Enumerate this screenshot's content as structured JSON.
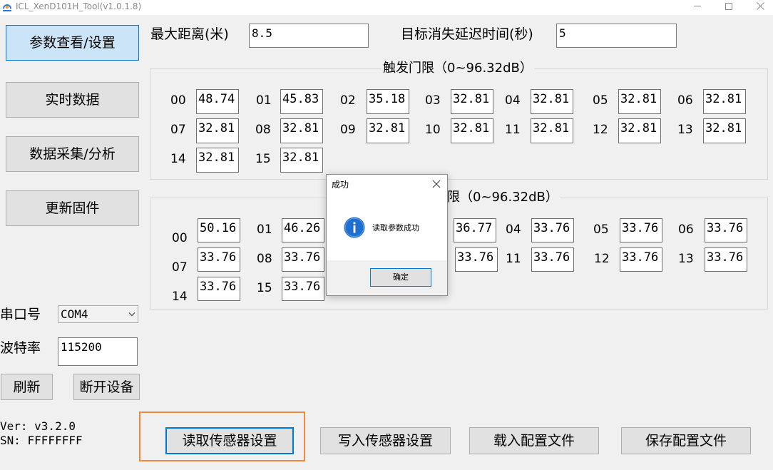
{
  "window": {
    "title": "ICL_XenD101H_Tool(v1.0.1.8)",
    "icon": "app-logo-icon",
    "controls": [
      "minimize-icon",
      "maximize-icon",
      "close-icon"
    ]
  },
  "sidebar": {
    "items": [
      {
        "label": "参数查看/设置",
        "selected": true
      },
      {
        "label": "实时数据",
        "selected": false
      },
      {
        "label": "数据采集/分析",
        "selected": false
      },
      {
        "label": "更新固件",
        "selected": false
      }
    ]
  },
  "connection": {
    "port_label": "串口号",
    "port_value": "COM4",
    "baud_label": "波特率",
    "baud_value": "115200",
    "refresh_label": "刷新",
    "disconnect_label": "断开设备"
  },
  "device_info": {
    "version": "Ver: v3.2.0",
    "sn": "SN: FFFFFFFF"
  },
  "params": {
    "max_distance_label": "最大距离(米)",
    "max_distance_value": "8.5",
    "disappear_delay_label": "目标消失延迟时间(秒)",
    "disappear_delay_value": "5"
  },
  "trigger_threshold": {
    "title": "触发门限（0~96.32dB）",
    "gates": [
      {
        "id": "00",
        "value": "48.74"
      },
      {
        "id": "01",
        "value": "45.83"
      },
      {
        "id": "02",
        "value": "35.18"
      },
      {
        "id": "03",
        "value": "32.81"
      },
      {
        "id": "04",
        "value": "32.81"
      },
      {
        "id": "05",
        "value": "32.81"
      },
      {
        "id": "06",
        "value": "32.81"
      },
      {
        "id": "07",
        "value": "32.81"
      },
      {
        "id": "08",
        "value": "32.81"
      },
      {
        "id": "09",
        "value": "32.81"
      },
      {
        "id": "10",
        "value": "32.81"
      },
      {
        "id": "11",
        "value": "32.81"
      },
      {
        "id": "12",
        "value": "32.81"
      },
      {
        "id": "13",
        "value": "32.81"
      },
      {
        "id": "14",
        "value": "32.81"
      },
      {
        "id": "15",
        "value": "32.81"
      }
    ]
  },
  "second_threshold": {
    "title_visible": "限（0~96.32dB）",
    "gates": [
      {
        "id": "00",
        "value": "50.16"
      },
      {
        "id": "01",
        "value": "46.26"
      },
      {
        "value": "36.77"
      },
      {
        "id": "04",
        "value": "33.76"
      },
      {
        "id": "05",
        "value": "33.76"
      },
      {
        "id": "06",
        "value": "33.76"
      },
      {
        "id": "07",
        "value": "33.76"
      },
      {
        "id": "08",
        "value": "33.76"
      },
      {
        "value": "33.76"
      },
      {
        "id": "11",
        "value": "33.76"
      },
      {
        "id": "12",
        "value": "33.76"
      },
      {
        "id": "13",
        "value": "33.76"
      },
      {
        "id": "14",
        "value": "33.76"
      },
      {
        "id": "15",
        "value": "33.76"
      }
    ]
  },
  "dialog": {
    "title": "成功",
    "message": "读取参数成功",
    "ok_label": "确定",
    "icon": "info-icon"
  },
  "actions": {
    "read": {
      "label": "读取传感器设置",
      "focused": true
    },
    "write": {
      "label": "写入传感器设置",
      "focused": false
    },
    "load": {
      "label": "载入配置文件",
      "focused": false
    },
    "save": {
      "label": "保存配置文件",
      "focused": false
    }
  },
  "colors": {
    "accent": "#0078d7",
    "selected_bg": "#cce4f7",
    "highlight": "#f0883e",
    "info": "#1f6fcf"
  }
}
